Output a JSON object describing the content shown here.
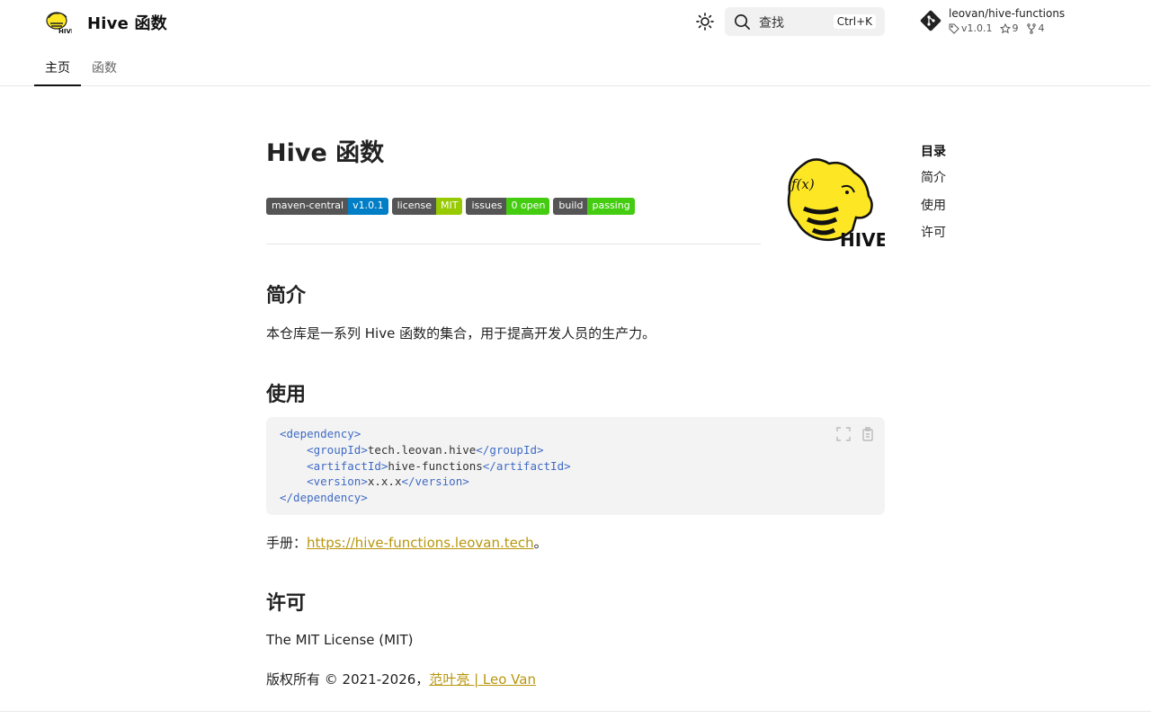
{
  "header": {
    "site_title": "Hive 函数",
    "search": {
      "label": "查找",
      "shortcut": "Ctrl+K"
    },
    "repo": {
      "name": "leovan/hive-functions",
      "version": "v1.0.1",
      "stars": "9",
      "forks": "4"
    },
    "tabs": [
      {
        "label": "主页",
        "active": true
      },
      {
        "label": "函数",
        "active": false
      }
    ]
  },
  "main": {
    "title": "Hive 函数",
    "badges": [
      {
        "left": "maven-central",
        "right": "v1.0.1",
        "color": "#007ec6"
      },
      {
        "left": "license",
        "right": "MIT",
        "color": "#97ca00"
      },
      {
        "left": "issues",
        "right": "0 open",
        "color": "#4c1"
      },
      {
        "left": "build",
        "right": "passing",
        "color": "#4c1"
      }
    ],
    "intro": {
      "heading": "简介",
      "text": "本仓库是一系列 Hive 函数的集合，用于提高开发人员的生产力。"
    },
    "usage": {
      "heading": "使用",
      "code": {
        "l1_open": "<dependency>",
        "l2_open": "<groupId>",
        "l2_text": "tech.leovan.hive",
        "l2_close": "</groupId>",
        "l3_open": "<artifactId>",
        "l3_text": "hive-functions",
        "l3_close": "</artifactId>",
        "l4_open": "<version>",
        "l4_text": "x.x.x",
        "l4_close": "</version>",
        "l5_close": "</dependency>"
      },
      "manual_prefix": "手册：",
      "manual_link": "https://hive-functions.leovan.tech",
      "manual_suffix": "。"
    },
    "license": {
      "heading": "许可",
      "name": "The MIT License (MIT)",
      "copyright_prefix": "版权所有 © 2021-2026，",
      "author_link": "范叶亮 | Leo Van"
    }
  },
  "toc": {
    "title": "目录",
    "items": [
      "简介",
      "使用",
      "许可"
    ]
  },
  "colors": {
    "link": "#b8960d",
    "code_tag": "#3f6bc4",
    "hive_yellow": "#fde724"
  }
}
